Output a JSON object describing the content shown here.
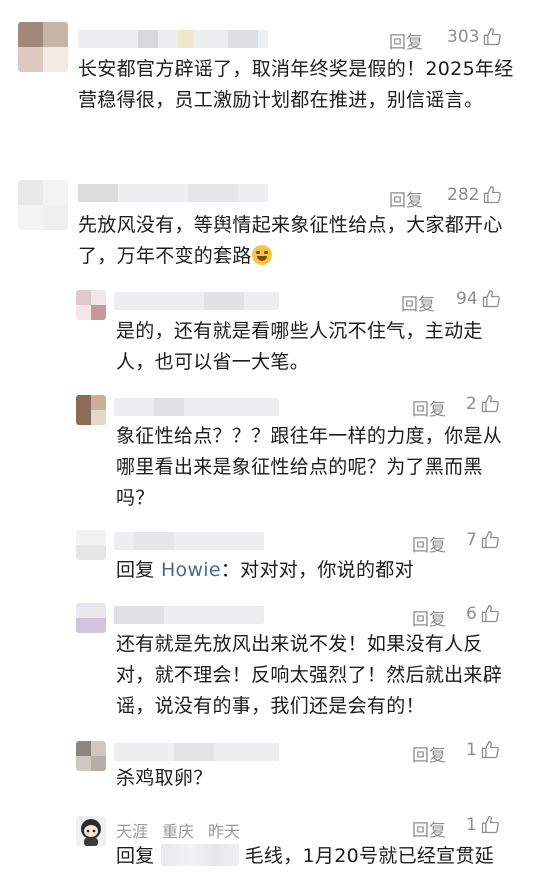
{
  "comments": [
    {
      "reply_label": "回复",
      "likes": "303",
      "text": "长安都官方辟谣了，取消年终奖是假的！2025年经营稳得很，员工激励计划都在推进，别信谣言。"
    },
    {
      "reply_label": "回复",
      "likes": "282",
      "text": "先放风没有，等舆情起来象征性给点，大家都开心了，万年不变的套路"
    },
    {
      "reply_label": "回复",
      "likes": "94",
      "text": "是的，还有就是看哪些人沉不住气，主动走人，也可以省一大笔。"
    },
    {
      "reply_label": "回复",
      "likes": "2",
      "text": "象征性给点？？？跟往年一样的力度，你是从哪里看出来是象征性给点的呢？为了黑而黑吗？"
    },
    {
      "reply_label": "回复",
      "likes": "7",
      "reply_prefix": "回复",
      "mention": "Howie",
      "text": "：对对对，你说的都对"
    },
    {
      "reply_label": "回复",
      "likes": "6",
      "text": "还有就是先放风出来说不发！如果没有人反对，就不理会！反响太强烈了！然后就出来辟谣，说没有的事，我们还是会有的！"
    },
    {
      "reply_label": "回复",
      "likes": "1",
      "text": "杀鸡取卵？"
    },
    {
      "reply_label": "回复",
      "likes": "1",
      "user": "天涯",
      "location": "重庆",
      "time": "昨天",
      "reply_prefix": "回复",
      "text": "毛线，1月20号就已经宣贯延"
    }
  ],
  "icons": {
    "like": "thumbs-up-icon"
  }
}
